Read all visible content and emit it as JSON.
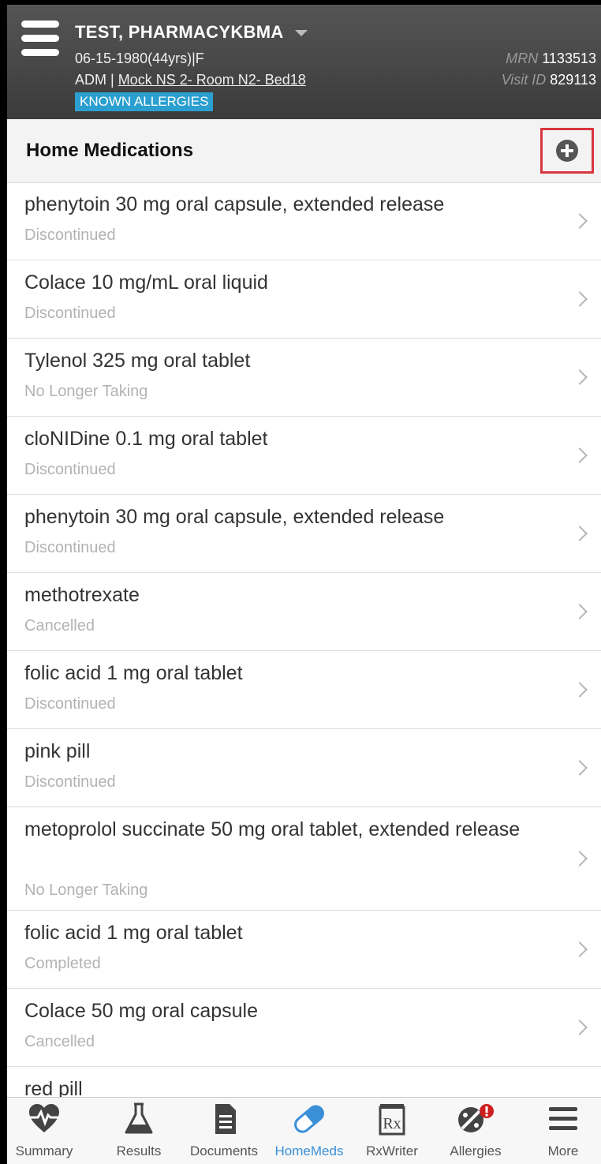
{
  "patient": {
    "name": "TEST, PHARMACYKBMA",
    "dob": "06-15-1980(44yrs)|F",
    "adm_prefix": "ADM | ",
    "location": "Mock NS 2- Room N2- Bed18",
    "allergy_badge": "KNOWN ALLERGIES",
    "mrn_label": "MRN",
    "mrn": "1133513",
    "visit_label": "Visit ID",
    "visit_id": "829113"
  },
  "section": {
    "title": "Home Medications"
  },
  "medications": [
    {
      "name": "phenytoin 30 mg oral capsule, extended release",
      "status": "Discontinued"
    },
    {
      "name": "Colace 10 mg/mL oral liquid",
      "status": "Discontinued"
    },
    {
      "name": "Tylenol 325 mg oral tablet",
      "status": "No Longer Taking"
    },
    {
      "name": "cloNIDine 0.1 mg oral tablet",
      "status": "Discontinued"
    },
    {
      "name": "phenytoin 30 mg oral capsule, extended release",
      "status": "Discontinued"
    },
    {
      "name": "methotrexate",
      "status": "Cancelled"
    },
    {
      "name": "folic acid 1 mg oral tablet",
      "status": "Discontinued"
    },
    {
      "name": "pink pill",
      "status": "Discontinued"
    },
    {
      "name": "metoprolol succinate 50 mg oral tablet, extended release",
      "status": "No Longer Taking"
    },
    {
      "name": "folic acid 1 mg oral tablet",
      "status": "Completed"
    },
    {
      "name": "Colace 50 mg oral capsule",
      "status": "Cancelled"
    },
    {
      "name": "red pill",
      "status": ""
    }
  ],
  "tabs": [
    {
      "label": "Summary",
      "icon": "heart-pulse-icon"
    },
    {
      "label": "Results",
      "icon": "flask-icon"
    },
    {
      "label": "Documents",
      "icon": "document-icon"
    },
    {
      "label": "HomeMeds",
      "icon": "pill-icon",
      "active": true
    },
    {
      "label": "RxWriter",
      "icon": "rx-icon"
    },
    {
      "label": "Allergies",
      "icon": "allergy-icon"
    },
    {
      "label": "More",
      "icon": "menu-icon"
    }
  ],
  "colors": {
    "accent": "#3a8fd8",
    "allergy_badge": "#2b9fcf",
    "highlight_border": "#d9363e",
    "alert": "#cc1f1f"
  }
}
